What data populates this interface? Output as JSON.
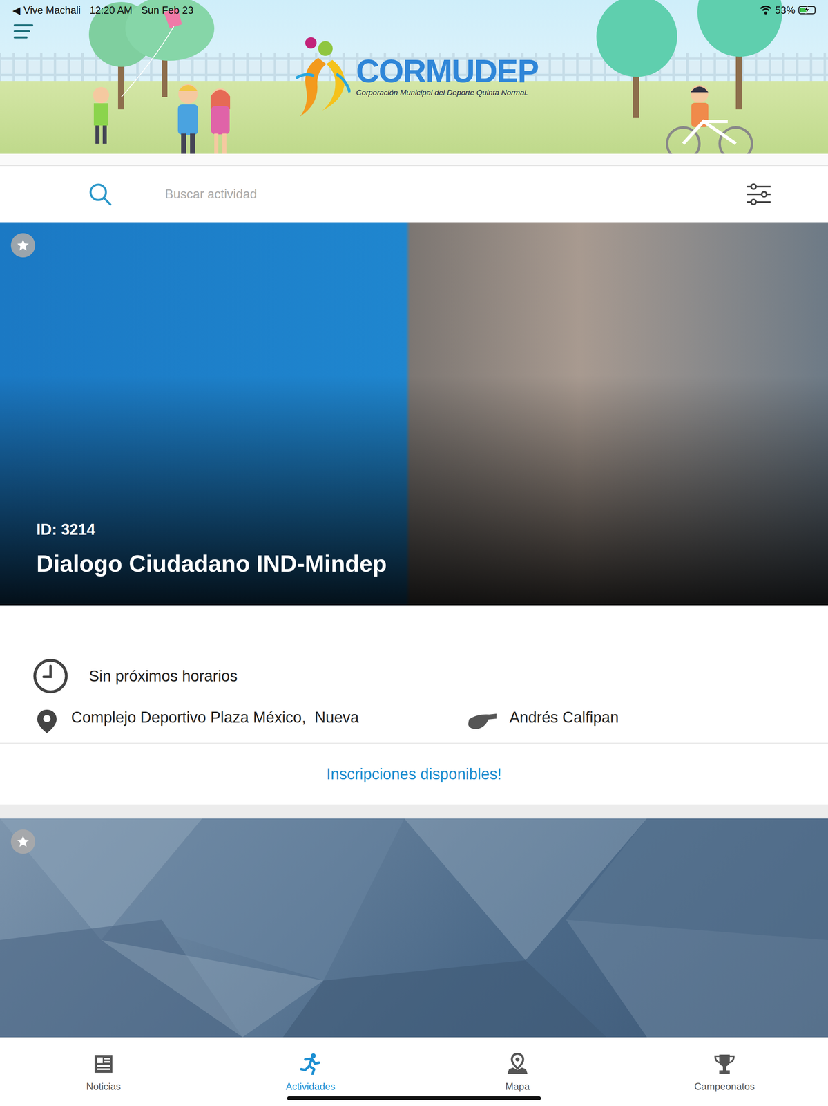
{
  "status_bar": {
    "back": "◀",
    "app": "Vive Machali",
    "time": "12:20 AM",
    "date": "Sun Feb 23",
    "battery": "53%",
    "battery_level": 0.53,
    "charging": true
  },
  "header": {
    "logo": "CORMUDEP",
    "subtitle": "Corporación Municipal del Deporte Quinta Normal."
  },
  "search": {
    "placeholder": "Buscar actividad"
  },
  "activities": [
    {
      "id_label": "ID: 3214",
      "title": "Dialogo Ciudadano IND-Mindep",
      "favorite": false,
      "schedule": "Sin próximos horarios",
      "location": "Complejo Deportivo Plaza México,  Nueva",
      "instructor": "Andrés Calfipan",
      "registration": "Inscripciones disponibles!"
    },
    {
      "favorite": false
    }
  ],
  "tabs": [
    {
      "label": "Noticias",
      "selected": false
    },
    {
      "label": "Actividades",
      "selected": true
    },
    {
      "label": "Mapa",
      "selected": false
    },
    {
      "label": "Campeonatos",
      "selected": false
    }
  ]
}
